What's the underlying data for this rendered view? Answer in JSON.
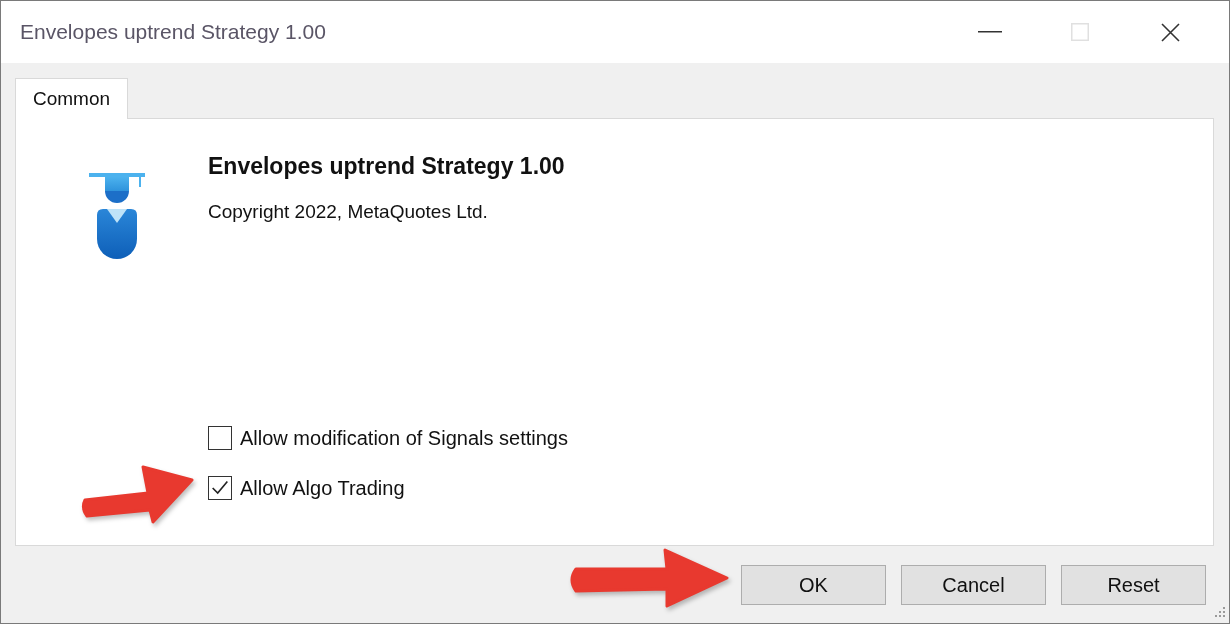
{
  "window": {
    "title": "Envelopes uptrend Strategy 1.00",
    "buttons": [
      {
        "kind": "minimize",
        "disabled": false
      },
      {
        "kind": "maximize",
        "disabled": true
      },
      {
        "kind": "close",
        "disabled": false
      }
    ]
  },
  "tabs": [
    {
      "label": "Common",
      "selected": true
    }
  ],
  "info": {
    "title": "Envelopes uptrend Strategy 1.00",
    "copyright": "Copyright 2022, MetaQuotes Ltd."
  },
  "options": [
    {
      "label": "Allow modification of Signals settings",
      "checked": false,
      "marked_by_arrow": false
    },
    {
      "label": "Allow Algo Trading",
      "checked": true,
      "marked_by_arrow": true
    }
  ],
  "buttons": [
    {
      "label": "OK",
      "marked_by_arrow": true
    },
    {
      "label": "Cancel",
      "marked_by_arrow": false
    },
    {
      "label": "Reset",
      "marked_by_arrow": false
    }
  ]
}
